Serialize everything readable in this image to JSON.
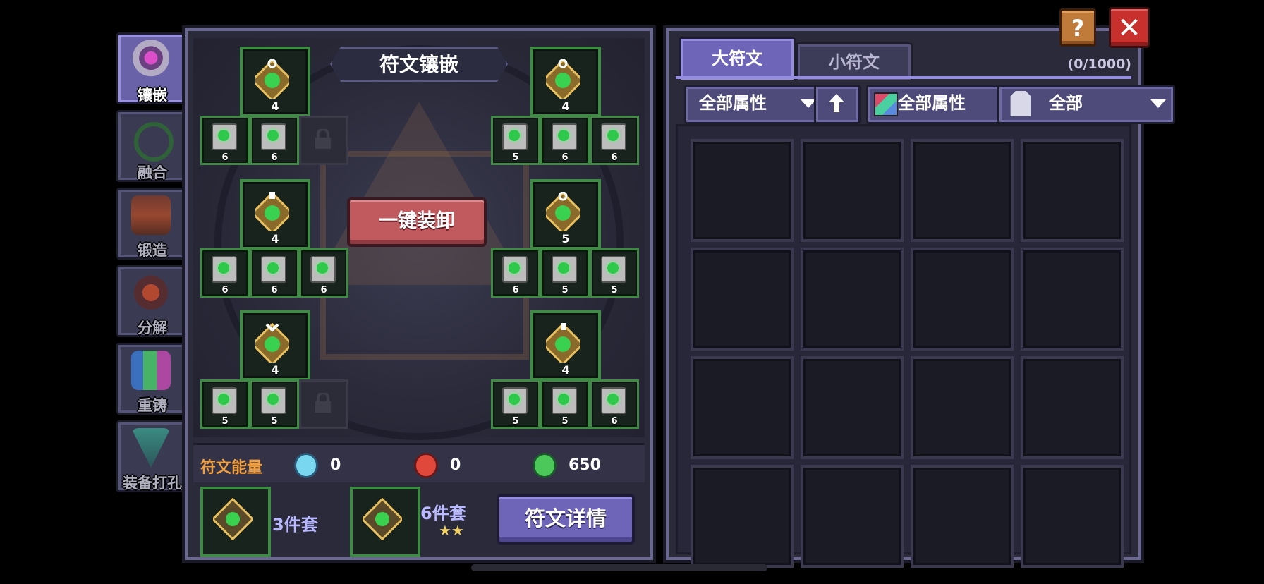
{
  "sidebar": {
    "items": [
      {
        "label": "镶嵌",
        "icon": "horns-gem-icon",
        "active": true
      },
      {
        "label": "融合",
        "icon": "fusion-rings-icon",
        "active": false
      },
      {
        "label": "锻造",
        "icon": "anvil-icon",
        "active": false
      },
      {
        "label": "分解",
        "icon": "decompose-icon",
        "active": false
      },
      {
        "label": "重铸",
        "icon": "crystals-icon",
        "active": false
      },
      {
        "label": "装备打孔",
        "icon": "drill-icon",
        "active": false
      }
    ]
  },
  "board": {
    "title": "符文镶嵌",
    "unequip_label": "一键装卸",
    "big_slots": [
      {
        "level": "4"
      },
      {
        "level": "4"
      },
      {
        "level": "4"
      },
      {
        "level": "5"
      },
      {
        "level": "4"
      },
      {
        "level": "4"
      }
    ],
    "small_rows": [
      [
        "6",
        "6",
        "locked",
        "5",
        "6",
        "6"
      ],
      [
        "6",
        "6",
        "6",
        "6",
        "5",
        "5"
      ],
      [
        "5",
        "5",
        "locked",
        "5",
        "5",
        "6"
      ]
    ]
  },
  "energy": {
    "label": "符文能量",
    "items": [
      {
        "icon": "blue-energy-icon",
        "value": "0",
        "color": "#7ad7f0"
      },
      {
        "icon": "red-energy-icon",
        "value": "0",
        "color": "#e0483c"
      },
      {
        "icon": "green-energy-icon",
        "value": "650",
        "color": "#4cc85a"
      }
    ]
  },
  "sets": {
    "set1_label": "3件套",
    "set2_label": "6件套",
    "set2_stars": "★★",
    "detail_button": "符文详情"
  },
  "inventory": {
    "tab_big": "大符文",
    "tab_small": "小符文",
    "count": "(0/1000)",
    "filter1": "全部属性",
    "sort_icon": "arrow-up-icon",
    "filter2": "全部属性",
    "filter3": "全部",
    "cells": 16
  },
  "top": {
    "help": "?",
    "close": "✕"
  },
  "colors": {
    "accent": "#6e65b8",
    "slot_border": "#3f8a45",
    "danger": "#c05a5f",
    "energy_label": "#f0a040"
  }
}
